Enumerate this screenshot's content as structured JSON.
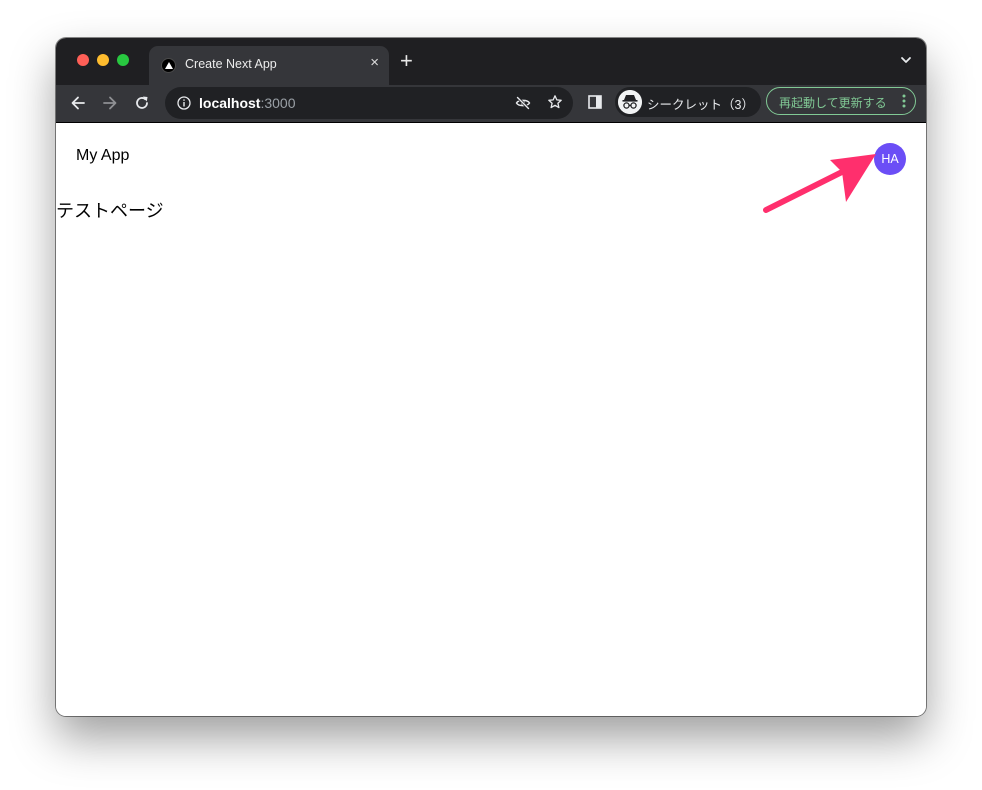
{
  "browser": {
    "tab": {
      "title": "Create Next App",
      "close_glyph": "×"
    },
    "new_tab_glyph": "+",
    "address_bar": {
      "host": "localhost",
      "port": ":3000"
    },
    "incognito": {
      "label": "シークレット（3）"
    },
    "relaunch": {
      "label": "再起動して更新する"
    },
    "colors": {
      "tab_strip": "#1f1f22",
      "toolbar": "#35363a",
      "relaunch_accent": "#81c995"
    }
  },
  "page": {
    "header": {
      "app_name": "My App",
      "avatar": {
        "initials": "HA",
        "color": "#6b4ef6"
      }
    },
    "heading": "テストページ"
  },
  "annotation": {
    "arrow_color": "#ff2f6d"
  }
}
